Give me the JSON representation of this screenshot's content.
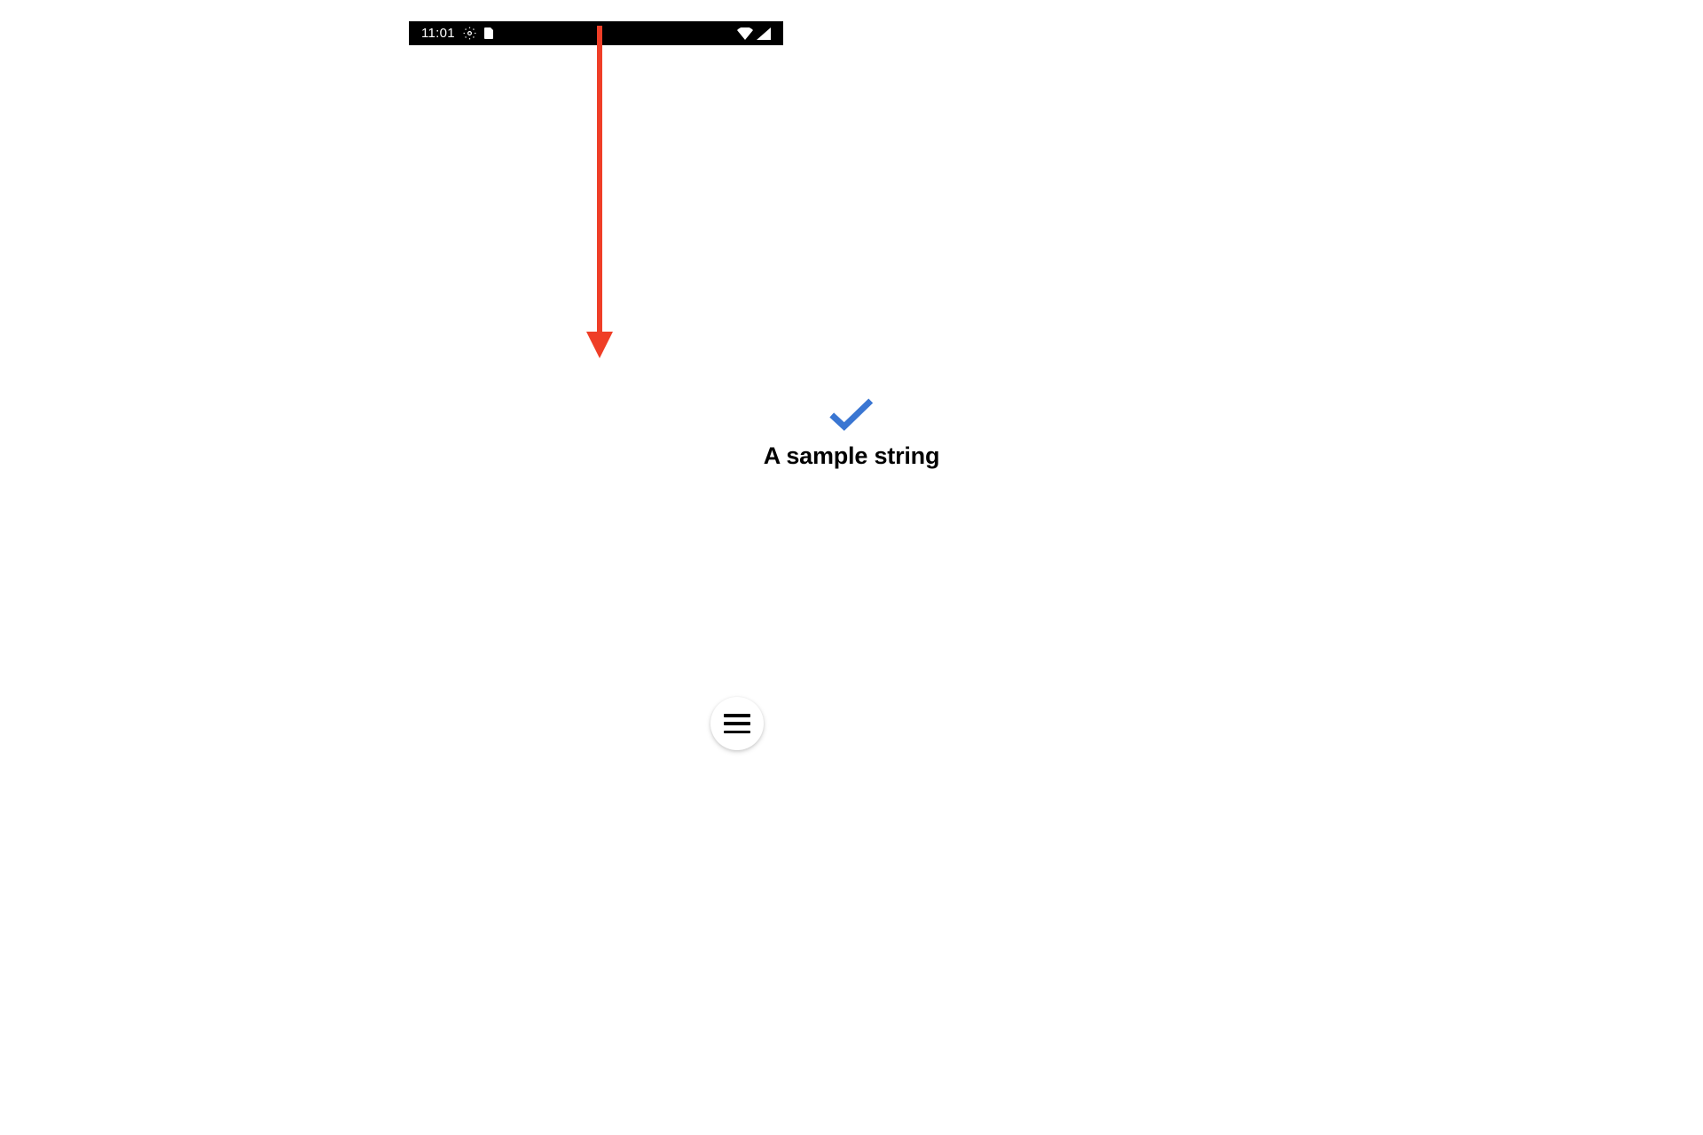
{
  "status_bar": {
    "time": "11:01",
    "icons": {
      "gear": "gear-icon",
      "sim": "sim-icon",
      "wifi": "wifi-icon",
      "signal": "signal-icon"
    }
  },
  "annotation": {
    "arrow_color": "#ef3e27"
  },
  "content": {
    "check_color": "#3a76d2",
    "message": "A sample string"
  },
  "fab": {
    "icon": "hamburger-menu-icon"
  }
}
